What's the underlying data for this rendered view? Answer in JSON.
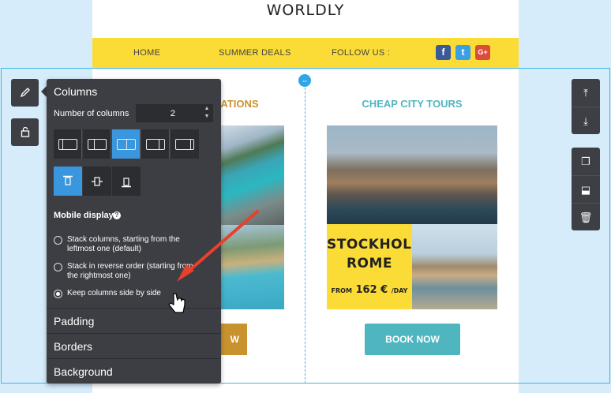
{
  "email": {
    "logo": "WORLDLY",
    "nav": {
      "home": "HOME",
      "deals": "SUMMER DEALS",
      "follow": "FOLLOW US :"
    },
    "social": {
      "facebook": "f",
      "twitter": "t",
      "google": "G+"
    },
    "col1": {
      "title": "NATIONS",
      "button": "W"
    },
    "col2": {
      "title": "CHEAP CITY TOURS",
      "promo_city_line1": "STOCKHOLM",
      "promo_city_line2": "ROME",
      "promo_from": "FROM",
      "promo_price": "162 €",
      "promo_unit": "/DAY",
      "button": "BOOK NOW"
    }
  },
  "panel": {
    "title": "Columns",
    "num_columns_label": "Number of columns",
    "num_columns_value": "2",
    "layout_options": [
      "one-wide",
      "left-narrow",
      "equal",
      "right-narrow",
      "right-wide"
    ],
    "layout_selected": "equal",
    "valign_options": [
      "top",
      "middle",
      "bottom"
    ],
    "valign_selected": "top",
    "mobile_display_label": "Mobile display",
    "mobile_options": [
      {
        "label_line1": "Stack columns, starting from the",
        "label_line2": "leftmost one (default)",
        "checked": false
      },
      {
        "label_line1": "Stack in reverse order (starting from",
        "label_line2": "the rightmost one)",
        "checked": false
      },
      {
        "label_line1": "Keep columns side by side",
        "label_line2": "",
        "checked": true
      }
    ],
    "sections": [
      "Padding",
      "Borders",
      "Background"
    ]
  },
  "toolbars": {
    "left": [
      "pencil-icon",
      "lock-icon"
    ],
    "right_group1": [
      "move-up-icon",
      "move-down-icon"
    ],
    "right_group2": [
      "duplicate-icon",
      "save-icon",
      "delete-icon"
    ]
  },
  "colors": {
    "accent": "#3a96dd",
    "yellow": "#fbdc36",
    "gold": "#c8922f",
    "teal": "#4fb6c0",
    "panel": "#3c3e44",
    "arrow": "#e8402a"
  }
}
